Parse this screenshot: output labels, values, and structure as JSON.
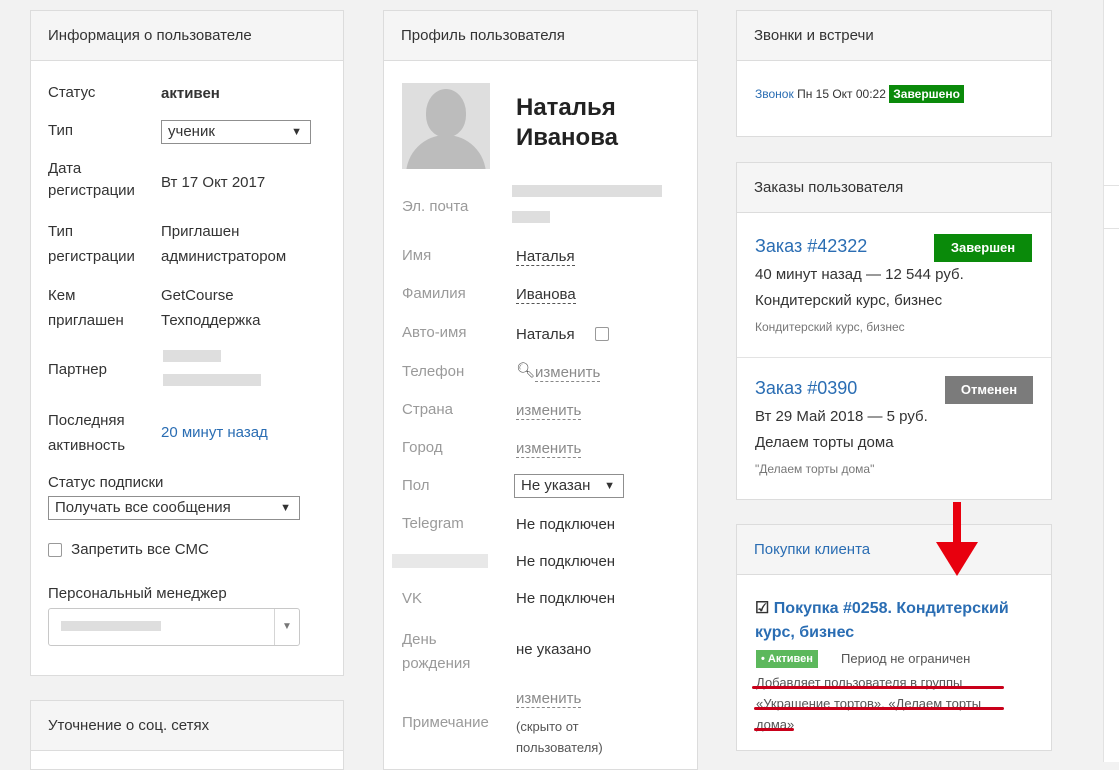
{
  "user_info": {
    "title": "Информация о пользователе",
    "status_label": "Статус",
    "status_value": "активен",
    "type_label": "Тип",
    "type_value": "ученик",
    "reg_date_label1": "Дата",
    "reg_date_label2": "регистрации",
    "reg_date_value": "Вт 17 Окт 2017",
    "reg_type_label1": "Тип",
    "reg_type_label2": "регистрации",
    "reg_type_value1": "Приглашен",
    "reg_type_value2": "администратором",
    "invited_label1": "Кем",
    "invited_label2": "приглашен",
    "invited_value1": "GetCourse",
    "invited_value2": "Техподдержка",
    "partner_label": "Партнер",
    "last_activity_label1": "Последняя",
    "last_activity_label2": "активность",
    "last_activity_value": "20 минут назад",
    "subscription_label": "Статус подписки",
    "subscription_value": "Получать все сообщения",
    "sms_label": "Запретить все СМС",
    "manager_label": "Персональный менеджер"
  },
  "social": {
    "title": "Уточнение о соц. сетях"
  },
  "profile": {
    "title": "Профиль пользователя",
    "first_name": "Наталья",
    "last_name": "Иванова",
    "email_label": "Эл. почта",
    "name_label": "Имя",
    "name_value": "Наталья",
    "surname_label": "Фамилия",
    "surname_value": "Иванова",
    "autoname_label": "Авто-имя",
    "autoname_value": "Наталья",
    "phone_label": "Телефон",
    "phone_link": "изменить",
    "country_label": "Страна",
    "country_link": "изменить",
    "city_label": "Город",
    "city_link": "изменить",
    "gender_label": "Пол",
    "gender_value": "Не указан",
    "telegram_label": "Telegram",
    "telegram_value": "Не подключен",
    "blurred_value": "Не подключен",
    "vk_label": "VK",
    "vk_value": "Не подключен",
    "birthday_label1": "День",
    "birthday_label2": "рождения",
    "birthday_value": "не указано",
    "note_label": "Примечание",
    "note_link": "изменить",
    "note_hint1": "(скрыто от",
    "note_hint2": "пользователя)"
  },
  "calls": {
    "title": "Звонки и встречи",
    "call_link": "Звонок",
    "call_date": "Пн 15 Окт 00:22",
    "call_status": "Завершено"
  },
  "orders": {
    "title": "Заказы пользователя",
    "items": [
      {
        "number": "Заказ #42322",
        "status": "Завершен",
        "meta": "40 минут назад — 12 544 руб.",
        "name": "Кондитерский курс, бизнес",
        "sub": "Кондитерский курс, бизнес"
      },
      {
        "number": "Заказ #0390",
        "status": "Отменен",
        "meta": "Вт 29 Май 2018 — 5 руб.",
        "name": "Делаем торты дома",
        "sub": "\"Делаем торты дома\""
      }
    ]
  },
  "purchases": {
    "title": "Покупки клиента",
    "purchase_title1": "Покупка #0258. Кондитерский",
    "purchase_title2": "курс, бизнес",
    "active_badge": "• Активен",
    "period": "Период не ограничен",
    "groups1": "Добавляет пользователя в группы",
    "groups2": "«Украшение тортов», «Делаем торты",
    "groups3": "дома»"
  },
  "colors": {
    "link": "#2a6db3",
    "success": "#0a8a0a",
    "cancel": "#7b7b7b",
    "active": "#5cb85c",
    "annotation": "#c9001a"
  }
}
